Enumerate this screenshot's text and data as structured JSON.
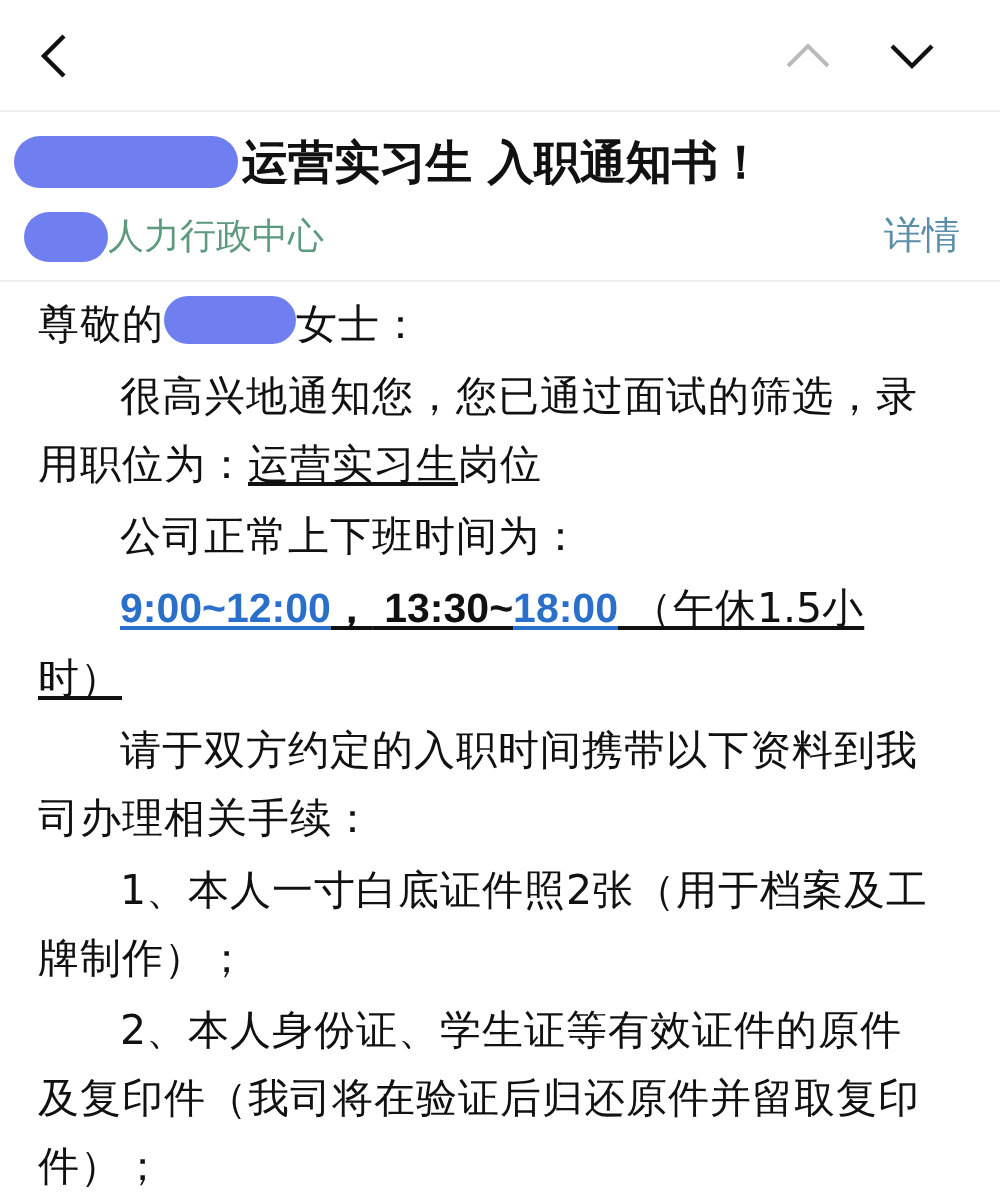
{
  "nav": {
    "back": {
      "disabled": false
    },
    "previous": {
      "disabled": true
    },
    "next": {
      "disabled": false
    }
  },
  "subject": {
    "segments": [
      {
        "kind": "redaction"
      },
      {
        "kind": "text",
        "text": "运营实习生 入职通知书！"
      }
    ]
  },
  "sender": {
    "avatar_redacted": true,
    "name": "人力行政中心",
    "details_link": "详情"
  },
  "body": [
    {
      "kind": "greeting",
      "segments": [
        {
          "kind": "text",
          "text": "尊敬的"
        },
        {
          "kind": "redaction"
        },
        {
          "kind": "text",
          "text": "女士："
        }
      ]
    },
    {
      "kind": "paragraph",
      "segments": [
        {
          "kind": "text",
          "text": "很高兴地通知您，您已通过面试的筛选，录用职位为："
        },
        {
          "kind": "text",
          "text": "运营实习生",
          "underline": true
        },
        {
          "kind": "text",
          "text": "岗位"
        }
      ]
    },
    {
      "kind": "paragraph",
      "segments": [
        {
          "kind": "text",
          "text": "公司正常上下班时间为："
        }
      ]
    },
    {
      "kind": "paragraph",
      "segments": [
        {
          "kind": "text",
          "text": "9:00~12:00",
          "underline": true,
          "bold": true,
          "color": "#2a6fc9"
        },
        {
          "kind": "text",
          "text": "，",
          "underline": true,
          "bold": true
        },
        {
          "kind": "text",
          "text": " 13:30~",
          "underline": true,
          "bold": true
        },
        {
          "kind": "text",
          "text": "18:00",
          "underline": true,
          "bold": true,
          "color": "#2a6fc9"
        },
        {
          "kind": "text",
          "text": " （午休1.5小时）",
          "underline": true
        }
      ]
    },
    {
      "kind": "paragraph",
      "segments": [
        {
          "kind": "text",
          "text": "请于双方约定的入职时间携带以下资料到我司办理相关手续："
        }
      ]
    },
    {
      "kind": "paragraph",
      "segments": [
        {
          "kind": "text",
          "text": "1、本人一寸白底证件照2张（用于档案及工牌制作）；"
        }
      ]
    },
    {
      "kind": "paragraph",
      "segments": [
        {
          "kind": "text",
          "text": "2、本人身份证、学生证等有效证件的原件及复印件（我司将在验证后归还原件并留取复印件）；"
        }
      ]
    }
  ]
}
